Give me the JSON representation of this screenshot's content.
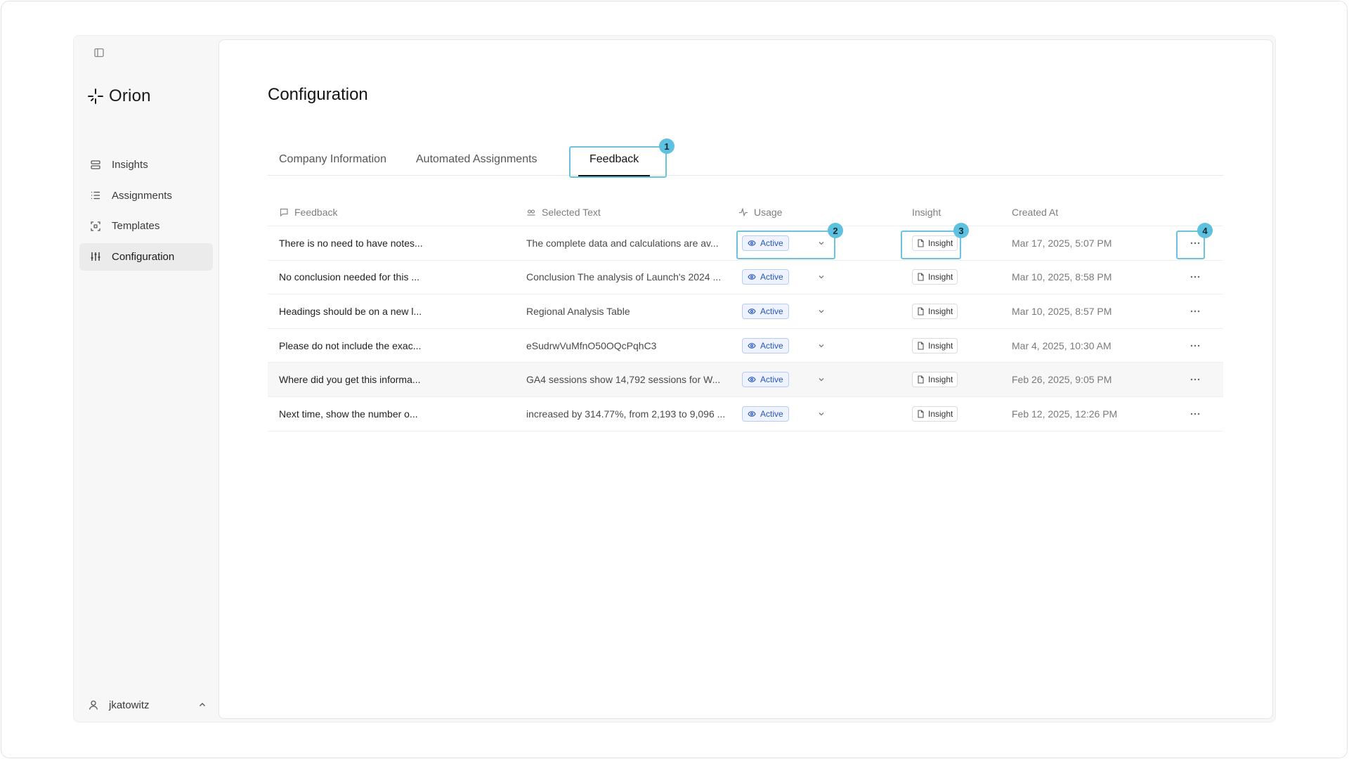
{
  "app": {
    "brand": "Orion",
    "nav": [
      {
        "label": "Insights",
        "icon": "stack-icon"
      },
      {
        "label": "Assignments",
        "icon": "list-icon"
      },
      {
        "label": "Templates",
        "icon": "scan-icon"
      },
      {
        "label": "Configuration",
        "icon": "sliders-icon",
        "active": true
      }
    ],
    "user": "jkatowitz"
  },
  "page": {
    "title": "Configuration",
    "tabs": [
      "Company Information",
      "Automated Assignments",
      "Feedback"
    ],
    "active_tab": "Feedback"
  },
  "table": {
    "headers": {
      "feedback": "Feedback",
      "selected_text": "Selected Text",
      "usage": "Usage",
      "insight": "Insight",
      "created_at": "Created At"
    },
    "rows": [
      {
        "feedback": "There is no need to have notes...",
        "selected_text": "The complete data and calculations are av...",
        "usage": "Active",
        "insight": "Insight",
        "created_at": "Mar 17, 2025, 5:07 PM"
      },
      {
        "feedback": "No conclusion needed for this ...",
        "selected_text": "Conclusion The analysis of Launch's 2024 ...",
        "usage": "Active",
        "insight": "Insight",
        "created_at": "Mar 10, 2025, 8:58 PM"
      },
      {
        "feedback": "Headings should be on a new l...",
        "selected_text": "Regional Analysis Table",
        "usage": "Active",
        "insight": "Insight",
        "created_at": "Mar 10, 2025, 8:57 PM"
      },
      {
        "feedback": "Please do not include the exac...",
        "selected_text": "eSudrwVuMfnO50OQcPqhC3",
        "usage": "Active",
        "insight": "Insight",
        "created_at": "Mar 4, 2025, 10:30 AM"
      },
      {
        "feedback": "Where did you get this informa...",
        "selected_text": "GA4 sessions show 14,792 sessions for W...",
        "usage": "Active",
        "insight": "Insight",
        "created_at": "Feb 26, 2025, 9:05 PM"
      },
      {
        "feedback": "Next time, show the number o...",
        "selected_text": "increased by 314.77%, from 2,193 to 9,096 ...",
        "usage": "Active",
        "insight": "Insight",
        "created_at": "Feb 12, 2025, 12:26 PM"
      }
    ]
  },
  "annotations": [
    "1",
    "2",
    "3",
    "4"
  ],
  "colors": {
    "accent_highlight": "#6ec3dc",
    "marker_fill": "#5ec1e0",
    "badge_border": "#b7cdf3",
    "badge_text": "#2a55b8"
  }
}
